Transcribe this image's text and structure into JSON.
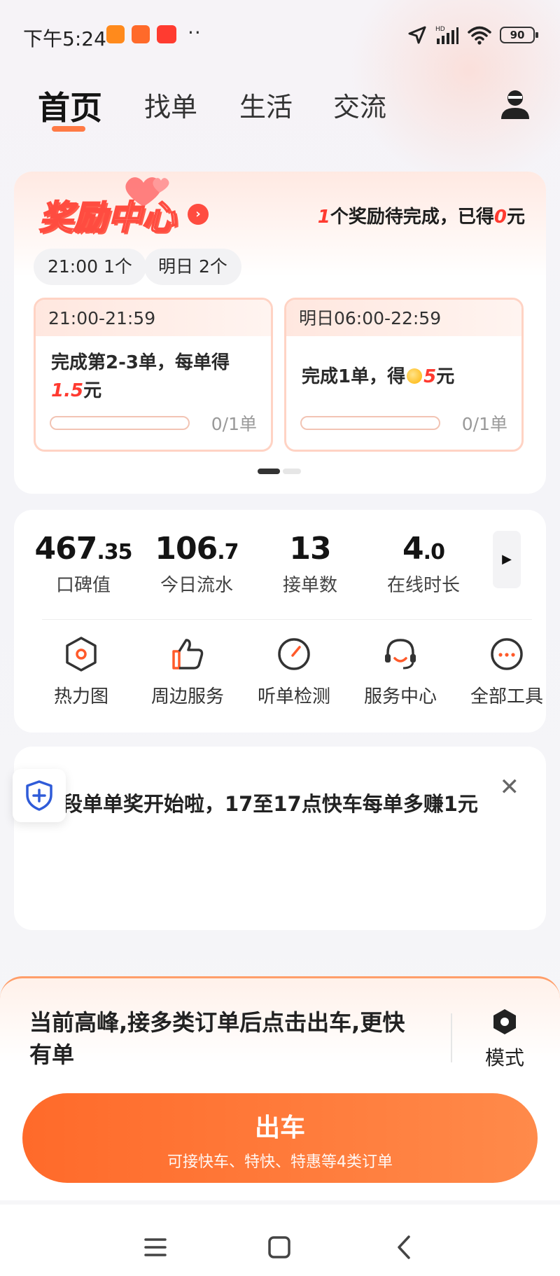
{
  "status_bar": {
    "time": "下午5:24",
    "dots": "··",
    "battery": "90",
    "network_label": "HD"
  },
  "nav": {
    "tabs": [
      {
        "label": "首页",
        "active": true
      },
      {
        "label": "找单",
        "active": false
      },
      {
        "label": "生活",
        "active": false
      },
      {
        "label": "交流",
        "active": false
      }
    ]
  },
  "reward": {
    "title": "奖励中心",
    "summary_pending_count": "1",
    "summary_mid": "个奖励待完成，已得",
    "summary_earned": "0",
    "summary_unit": "元",
    "chips": [
      "21:00 1个",
      "明日 2个"
    ],
    "tasks": [
      {
        "time": "21:00-21:59",
        "desc_a": "完成第2-3单，每单得",
        "desc_amount": "1.5",
        "desc_unit": "元",
        "progress": "0/1单"
      },
      {
        "time": "明日06:00-22:59",
        "desc_a": "完成1单，得",
        "desc_amount": "5",
        "desc_unit": "元",
        "progress": "0/1单"
      }
    ]
  },
  "stats": [
    {
      "int": "467",
      "dec": ".35",
      "label": "口碑值"
    },
    {
      "int": "106",
      "dec": ".7",
      "label": "今日流水"
    },
    {
      "int": "13",
      "dec": "",
      "label": "接单数"
    },
    {
      "int": "4",
      "dec": ".0",
      "label": "在线时长"
    }
  ],
  "tools": [
    {
      "label": "热力图",
      "icon": "heatmap-icon"
    },
    {
      "label": "周边服务",
      "icon": "thumbs-up-icon"
    },
    {
      "label": "听单检测",
      "icon": "gauge-icon"
    },
    {
      "label": "服务中心",
      "icon": "headset-icon"
    },
    {
      "label": "全部工具",
      "icon": "more-icon"
    }
  ],
  "notice": {
    "text": "时段单单奖开始啦，17至17点快车每单多赚1元"
  },
  "bottom": {
    "peak_text": "当前高峰,接多类订单后点击出车,更快有单",
    "mode_label": "模式",
    "go_title": "出车",
    "go_sub": "可接快车、特快、特惠等4类订单"
  },
  "colors": {
    "accent": "#ff6a2a",
    "reward_red": "#ff3a30",
    "tab_underline": "#ff7a45"
  }
}
